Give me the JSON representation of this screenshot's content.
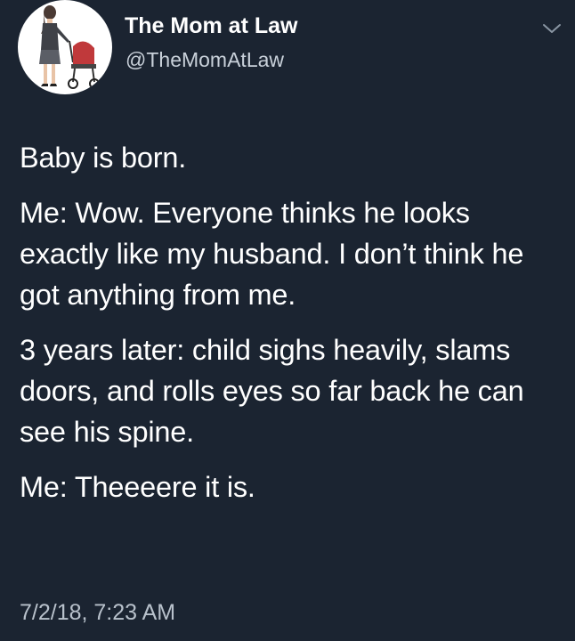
{
  "tweet": {
    "author": {
      "display_name": "The Mom at Law",
      "handle": "@TheMomAtLaw",
      "avatar_icon": "woman-with-stroller-icon"
    },
    "menu_icon": "chevron-down-icon",
    "paragraphs": [
      "Baby is born.",
      "Me: Wow. Everyone thinks he looks exactly like my husband. I don’t think he got anything from me.",
      "3 years later: child sighs heavily, slams doors, and rolls eyes so far back he can see his spine.",
      "Me: Theeeere it is."
    ],
    "timestamp": "7/2/18, 7:23 AM"
  },
  "colors": {
    "background": "#1b2431",
    "text": "#ffffff",
    "muted": "#b8c1cb"
  }
}
